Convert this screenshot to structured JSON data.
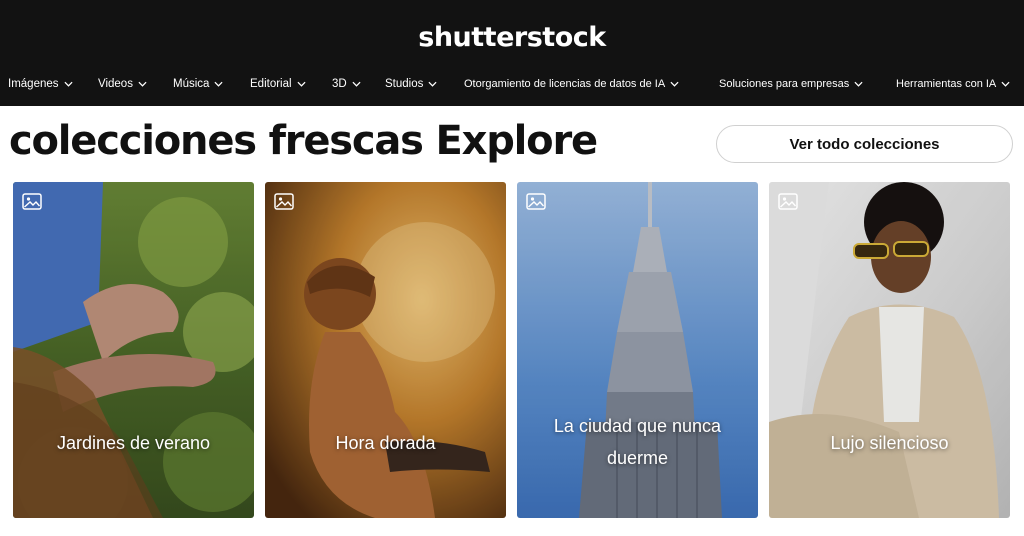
{
  "header": {
    "logo": "shutterstock",
    "nav": [
      {
        "label": "Imágenes",
        "icon": "chevron-down-icon"
      },
      {
        "label": "Videos",
        "icon": "chevron-down-icon"
      },
      {
        "label": "Música",
        "icon": "chevron-down-icon"
      },
      {
        "label": "Editorial",
        "icon": "chevron-down-icon"
      },
      {
        "label": "3D",
        "icon": "chevron-down-icon"
      },
      {
        "label": "Studios",
        "icon": "chevron-down-icon"
      },
      {
        "label": "Otorgamiento de licencias de datos de IA",
        "icon": "chevron-down-icon"
      },
      {
        "label": "Soluciones para empresas",
        "icon": "chevron-down-icon"
      },
      {
        "label": "Herramientas con IA",
        "icon": "chevron-down-icon"
      }
    ]
  },
  "section": {
    "title": "colecciones frescas Explore",
    "view_all": "Ver todo colecciones"
  },
  "collections": [
    {
      "title": "Jardines de verano",
      "icon": "image-icon"
    },
    {
      "title": "Hora dorada",
      "icon": "image-icon"
    },
    {
      "title": "La ciudad que nunca duerme",
      "icon": "image-icon"
    },
    {
      "title": "Lujo silencioso",
      "icon": "image-icon"
    }
  ],
  "colors": {
    "header_bg": "#121212",
    "text": "#111111",
    "button_border": "#d0d0d0"
  }
}
